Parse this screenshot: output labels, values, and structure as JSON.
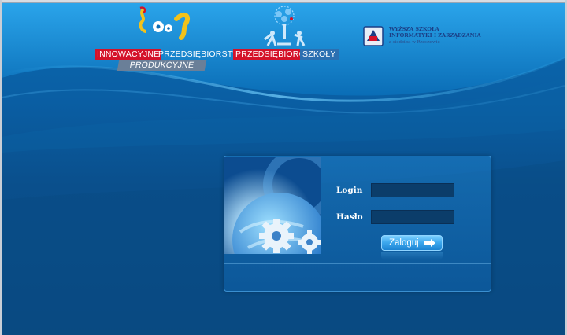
{
  "header": {
    "tagline_left": {
      "word1": "INNOWACYJNE",
      "word2": "PRZEDSIĘBIORSTWO",
      "word3": "PRODUKCYJNE"
    },
    "tagline_right": {
      "word1": "PRZEDSIĘBIORCZE",
      "word2": "SZKOŁY"
    },
    "university": {
      "line1": "WYŻSZA SZKOŁA",
      "line2": "INFORMATYKI I ZARZĄDZANIA",
      "line3": "z siedzibą w Rzeszowie"
    }
  },
  "login_form": {
    "login_label": "Login",
    "login_value": "",
    "password_label": "Hasło",
    "password_value": "",
    "submit_label": "Zaloguj"
  },
  "icons": {
    "logo": "gears-logo-icon",
    "tree": "tree-people-icon",
    "university": "university-crest-icon",
    "submit": "arrow-right-icon"
  },
  "colors": {
    "accent_red": "#d4122a",
    "accent_blue": "#2b6fb1",
    "background": "#0b4e86",
    "button": "#3ea9ee"
  }
}
